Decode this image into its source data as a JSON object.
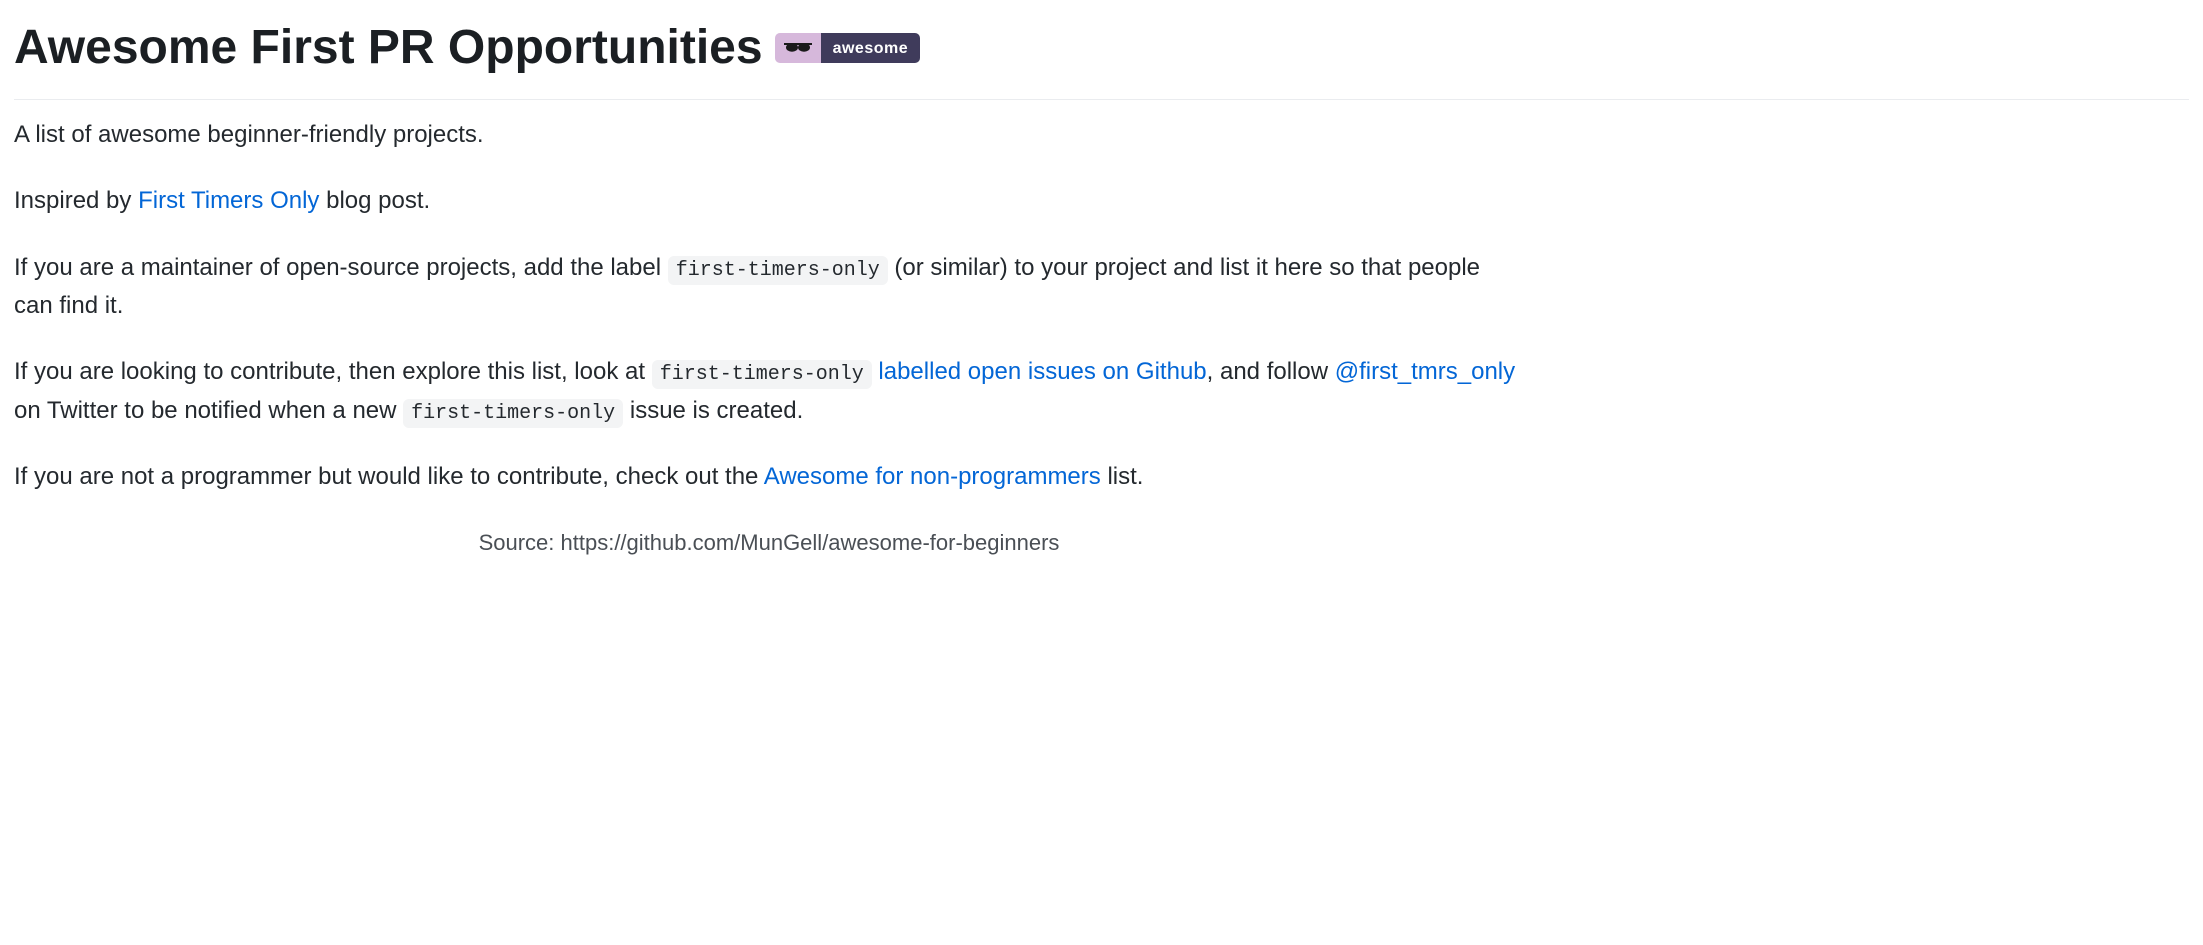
{
  "heading": {
    "title": "Awesome First PR Opportunities",
    "badge_text": "awesome"
  },
  "paragraphs": {
    "intro": "A list of awesome beginner-friendly projects.",
    "inspired_prefix": "Inspired by ",
    "inspired_link": "First Timers Only",
    "inspired_suffix": " blog post.",
    "maintainers_prefix": "If you are a maintainer of open-source projects, add the label ",
    "maintainers_code": "first-timers-only",
    "maintainers_suffix": " (or similar) to your project and list it here so that people can find it.",
    "contribute_prefix": "If you are looking to contribute, then explore this list, look at ",
    "contribute_code1": "first-timers-only",
    "contribute_link1": " labelled open issues on Github",
    "contribute_mid1": ", and follow ",
    "contribute_link2": "@first_tmrs_only",
    "contribute_mid2": " on Twitter to be notified when a new ",
    "contribute_code2": "first-timers-only",
    "contribute_suffix": " issue is created.",
    "nonprog_prefix": "If you are not a programmer but would like to contribute, check out the ",
    "nonprog_link": "Awesome for non-programmers",
    "nonprog_suffix": " list.",
    "source": "Source: https://github.com/MunGell/awesome-for-beginners"
  }
}
